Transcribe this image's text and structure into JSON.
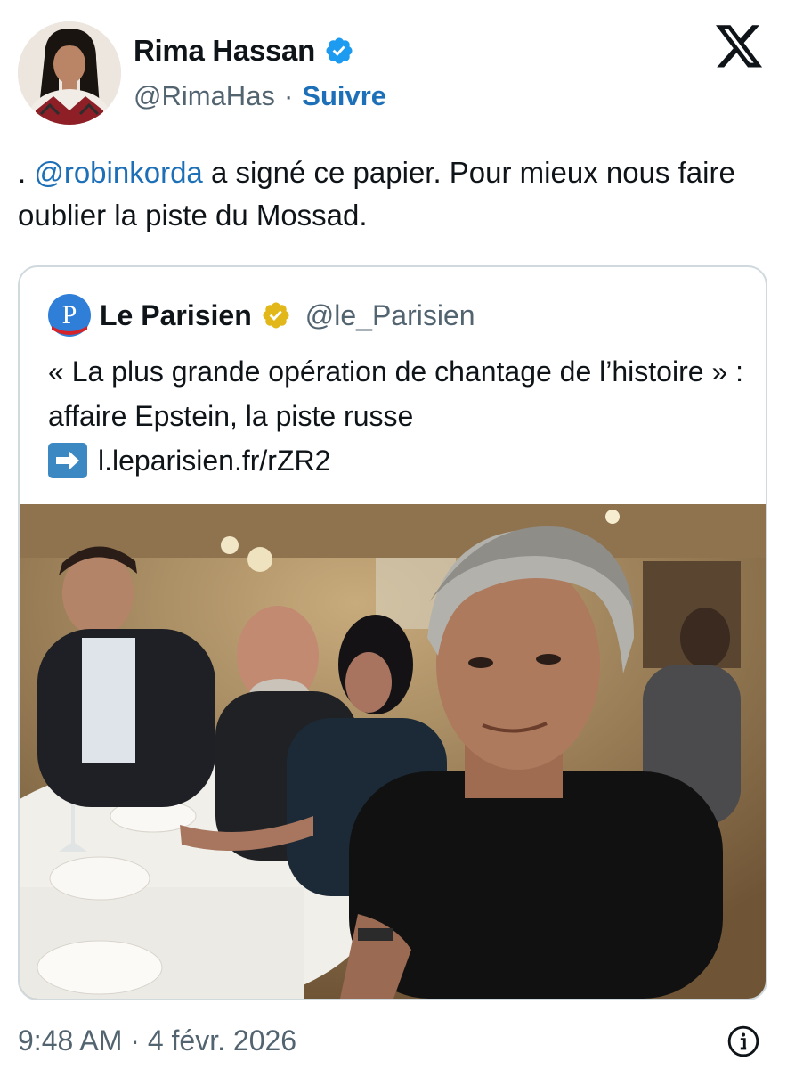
{
  "author": {
    "name": "Rima Hassan",
    "handle": "@RimaHas",
    "separator": "·",
    "follow_label": "Suivre"
  },
  "tweet": {
    "prefix": ". ",
    "mention": "@robinkorda",
    "text": " a signé ce papier. Pour mieux nous faire oublier la piste du Mossad."
  },
  "quote": {
    "name": "Le Parisien",
    "handle": "@le_Parisien",
    "text": "« La plus grande opération de chantage de l’histoire » : affaire Epstein, la piste russe",
    "link": "l.leparisien.fr/rZR2"
  },
  "footer": {
    "timestamp": "9:48 AM · 4 févr. 2026"
  },
  "icons": {
    "verified": "verified-badge-icon",
    "verified_gold": "gold-verified-badge-icon",
    "x_logo": "x-logo-icon",
    "arrow": "right-arrow-emoji-icon",
    "info": "info-icon"
  },
  "colors": {
    "link_blue": "#1d70b8",
    "verified_blue": "#1d9bf0",
    "verified_gold": "#e2b719",
    "secondary_text": "#536471",
    "border": "#cfd9de"
  }
}
